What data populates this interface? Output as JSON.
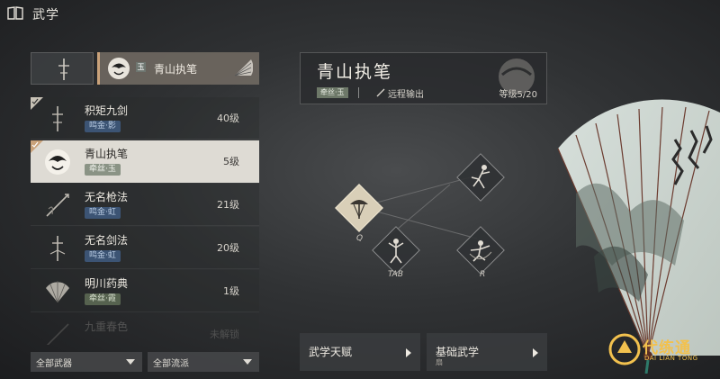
{
  "header": {
    "title": "武学",
    "icon": "book-icon"
  },
  "weapon_selector": {
    "selected_label": "青山执笔",
    "tier_glyph": "玉"
  },
  "skill_list": [
    {
      "name": "积矩九剑",
      "tag": "鸣金·影",
      "tag_color": "blue",
      "level": "40级",
      "checked": true,
      "icon": "sword-icon"
    },
    {
      "name": "青山执笔",
      "tag": "牵丝·玉",
      "tag_color": "green",
      "level": "5级",
      "checked": true,
      "active": true,
      "icon": "ink-portrait-icon"
    },
    {
      "name": "无名枪法",
      "tag": "鸣金·虹",
      "tag_color": "blue",
      "level": "21级",
      "icon": "spear-icon"
    },
    {
      "name": "无名剑法",
      "tag": "鸣金·虹",
      "tag_color": "blue",
      "level": "20级",
      "icon": "sword-icon"
    },
    {
      "name": "明川药典",
      "tag": "牵丝·霞",
      "tag_color": "green",
      "level": "1级",
      "icon": "fan-icon"
    },
    {
      "name": "九重春色",
      "tag": "",
      "tag_color": "blue",
      "level": "未解锁",
      "faded": true,
      "icon": "spear-icon"
    }
  ],
  "filters": {
    "weapons": "全部武器",
    "schools": "全部流派"
  },
  "detail": {
    "title": "青山执笔",
    "badge": "牵丝·玉",
    "type": "远程输出",
    "level": "等级5/20"
  },
  "skill_tree": {
    "keys": [
      "Q",
      "TAB",
      "R"
    ]
  },
  "bottom_buttons": {
    "talent": "武学天赋",
    "basic": "基础武学",
    "basic_sub": "扇"
  },
  "watermark": {
    "title": "代练通",
    "sub": "DAI LIAN TONG"
  },
  "colors": {
    "accent_gold": "#c9a27a",
    "tag_blue": "#3c5474",
    "tag_green": "#56624f",
    "watermark": "#f2c14e"
  }
}
